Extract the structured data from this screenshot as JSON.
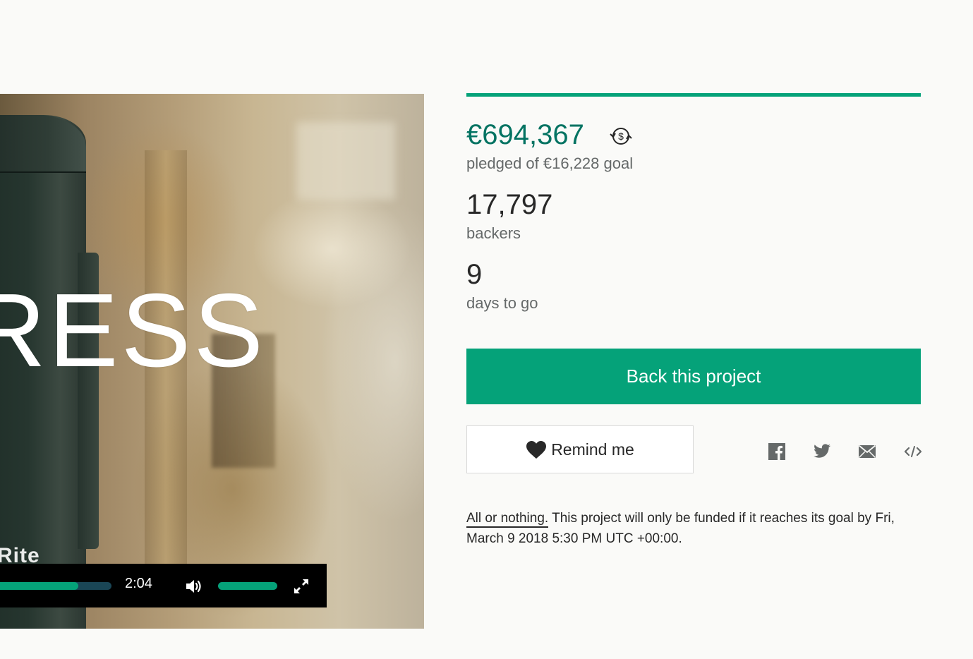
{
  "video": {
    "overlay_word": "RESS",
    "brand_text": "Rite",
    "time": "2:04",
    "progress_fraction": 0.72,
    "volume_fraction": 1.0
  },
  "campaign": {
    "funded_fraction": 1.0,
    "pledged": "€694,367",
    "pledged_caption": "pledged of €16,228 goal",
    "backers": "17,797",
    "backers_caption": "backers",
    "days": "9",
    "days_caption": "days to go"
  },
  "actions": {
    "back_label": "Back this project",
    "remind_label": "Remind me"
  },
  "share": [
    "facebook-icon",
    "twitter-icon",
    "email-icon",
    "embed-icon"
  ],
  "funding_note": {
    "term": "All or nothing.",
    "text": " This project will only be funded if it reaches its goal by Fri, March 9 2018 5:30 PM UTC +00:00."
  },
  "colors": {
    "accent": "#05a279",
    "pledged_text": "#037362",
    "track": "#1a4656"
  }
}
